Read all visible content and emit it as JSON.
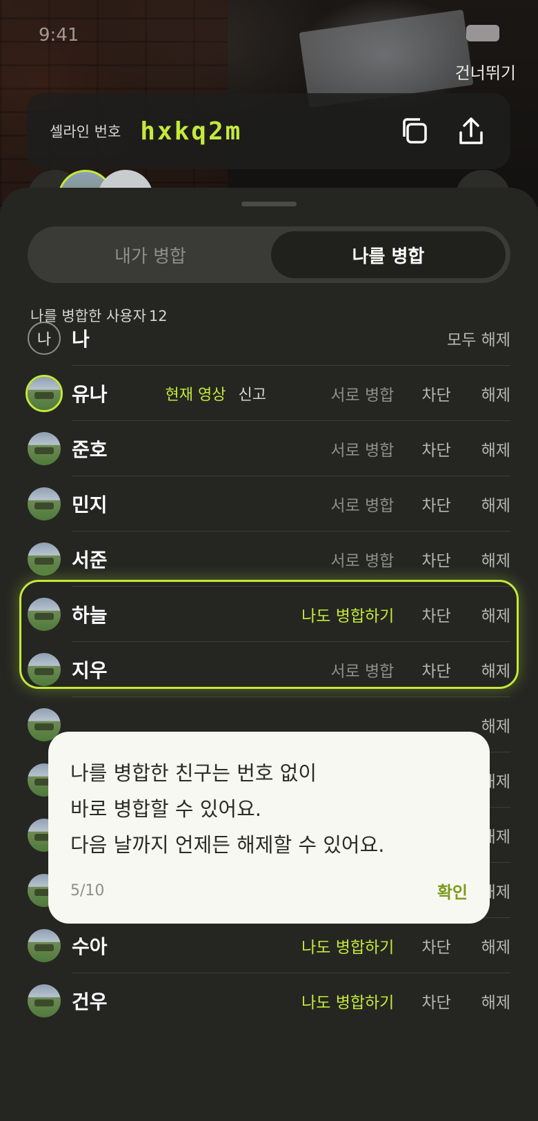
{
  "status": {
    "time": "9:41"
  },
  "header": {
    "skip_label": "건너뛰기"
  },
  "code_card": {
    "label": "셀라인 번호",
    "value": "hxkq2m",
    "copy_icon": "copy-icon",
    "share_icon": "share-icon"
  },
  "tabs": [
    {
      "label": "내가 병합",
      "selected": false
    },
    {
      "label": "나를 병합",
      "selected": true
    }
  ],
  "list": {
    "count_label": "나를 병합한 사용자",
    "count": "12",
    "me": {
      "avatar_text": "나",
      "name": "나",
      "release_all": "모두 해제"
    },
    "rows": [
      {
        "name": "유나",
        "tag_current": "현재 영상",
        "tag_report": "신고",
        "merge": "서로 병합",
        "block": "차단",
        "release": "해제"
      },
      {
        "name": "준호",
        "merge": "서로 병합",
        "block": "차단",
        "release": "해제"
      },
      {
        "name": "민지",
        "merge": "서로 병합",
        "block": "차단",
        "release": "해제"
      },
      {
        "name": "서준",
        "merge": "서로 병합",
        "block": "차단",
        "release": "해제"
      },
      {
        "name": "하늘",
        "merge": "나도 병합하기",
        "block": "차단",
        "release": "해제"
      },
      {
        "name": "지우",
        "merge": "서로 병합",
        "block": "차단",
        "release": "해제"
      },
      {
        "name": "",
        "merge": "",
        "block": "",
        "release": "해제"
      },
      {
        "name": "",
        "merge": "",
        "block": "",
        "release": "해제"
      },
      {
        "name": "",
        "merge": "",
        "block": "",
        "release": "해제"
      },
      {
        "name": "",
        "merge": "",
        "block": "",
        "release": "해제"
      },
      {
        "name": "수아",
        "merge": "나도 병합하기",
        "block": "차단",
        "release": "해제"
      },
      {
        "name": "건우",
        "merge": "나도 병합하기",
        "block": "차단",
        "release": "해제"
      }
    ]
  },
  "tooltip": {
    "line1": "나를 병합한 친구는 번호 없이",
    "line2": "바로 병합할 수 있어요.",
    "line3": "다음 날까지 언제든 해제할 수 있어요.",
    "page": "5/10",
    "confirm": "확인"
  },
  "colors": {
    "accent": "#c3ea3a",
    "sheet": "#252622",
    "tooltip_bg": "#f8f8f2"
  }
}
